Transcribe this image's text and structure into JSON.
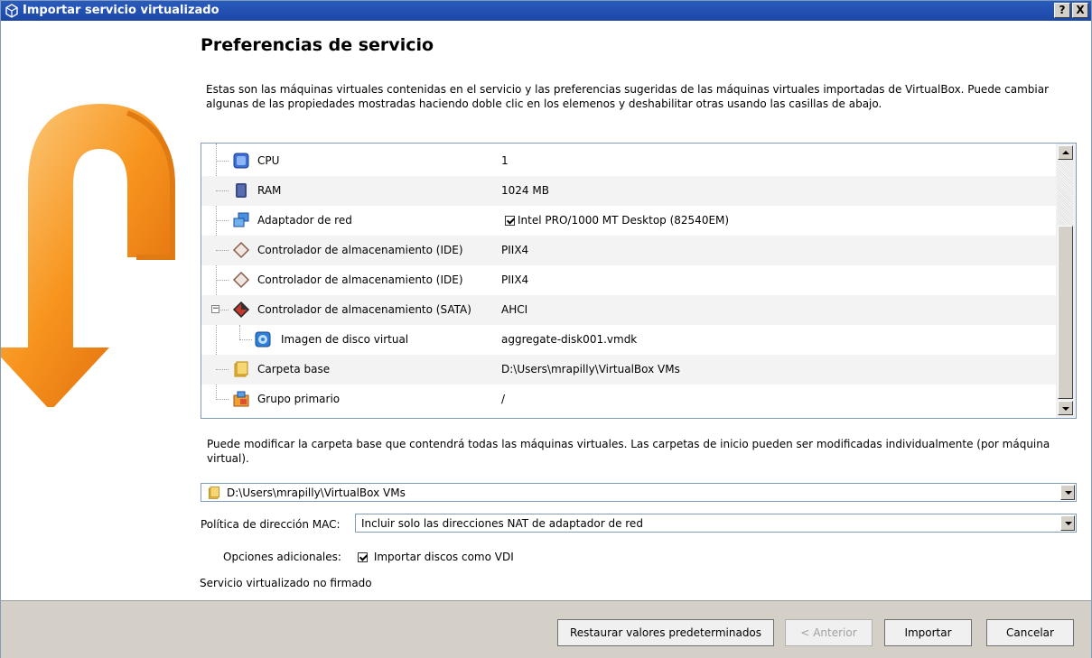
{
  "window": {
    "title": "Importar servicio virtualizado",
    "help_button": "?",
    "close_button": "X"
  },
  "heading": "Preferencias de servicio",
  "description": "Estas son las máquinas virtuales contenidas en el servicio y las preferencias sugeridas de las máquinas virtuales importadas de VirtualBox. Puede cambiar algunas de las propiedades mostradas haciendo doble clic en los elemenos y deshabilitar otras usando las casillas de abajo.",
  "tree": {
    "rows": [
      {
        "label": "CPU",
        "value": "1",
        "icon": "cpu-icon"
      },
      {
        "label": "RAM",
        "value": "1024 MB",
        "icon": "ram-icon"
      },
      {
        "label": "Adaptador de red",
        "value": "Intel PRO/1000 MT Desktop (82540EM)",
        "icon": "network-adapter-icon",
        "checked": true
      },
      {
        "label": "Controlador de almacenamiento (IDE)",
        "value": "PIIX4",
        "icon": "ide-controller-icon"
      },
      {
        "label": "Controlador de almacenamiento (IDE)",
        "value": "PIIX4",
        "icon": "ide-controller-icon"
      },
      {
        "label": "Controlador de almacenamiento (SATA)",
        "value": "AHCI",
        "icon": "sata-controller-icon",
        "expander": "−"
      },
      {
        "label": "Imagen de disco virtual",
        "value": "aggregate-disk001.vmdk",
        "icon": "virtual-disk-icon"
      },
      {
        "label": "Carpeta base",
        "value": "D:\\Users\\mrapilly\\VirtualBox VMs",
        "icon": "folder-icon"
      },
      {
        "label": "Grupo primario",
        "value": "/",
        "icon": "group-icon"
      }
    ]
  },
  "note": "Puede modificar la carpeta base que contendrá todas las máquinas virtuales. Las carpetas de inicio pueden ser modificadas individualmente (por máquina virtual).",
  "base_folder": {
    "value": "D:\\Users\\mrapilly\\VirtualBox VMs"
  },
  "mac_policy": {
    "label": "Política de dirección MAC:",
    "value": "Incluir solo las direcciones NAT de adaptador de red"
  },
  "additional_options": {
    "label": "Opciones adicionales:",
    "checkbox_label": "Importar discos como VDI",
    "checked": true
  },
  "unsigned_note": "Servicio virtualizado no firmado",
  "buttons": {
    "restore": "Restaurar valores predeterminados",
    "back": "< Anterior",
    "import": "Importar",
    "cancel": "Cancelar"
  },
  "colors": {
    "titlebar": "#1c47a6",
    "footer": "#d4d0c8",
    "accent_orange": "#f7941d"
  }
}
